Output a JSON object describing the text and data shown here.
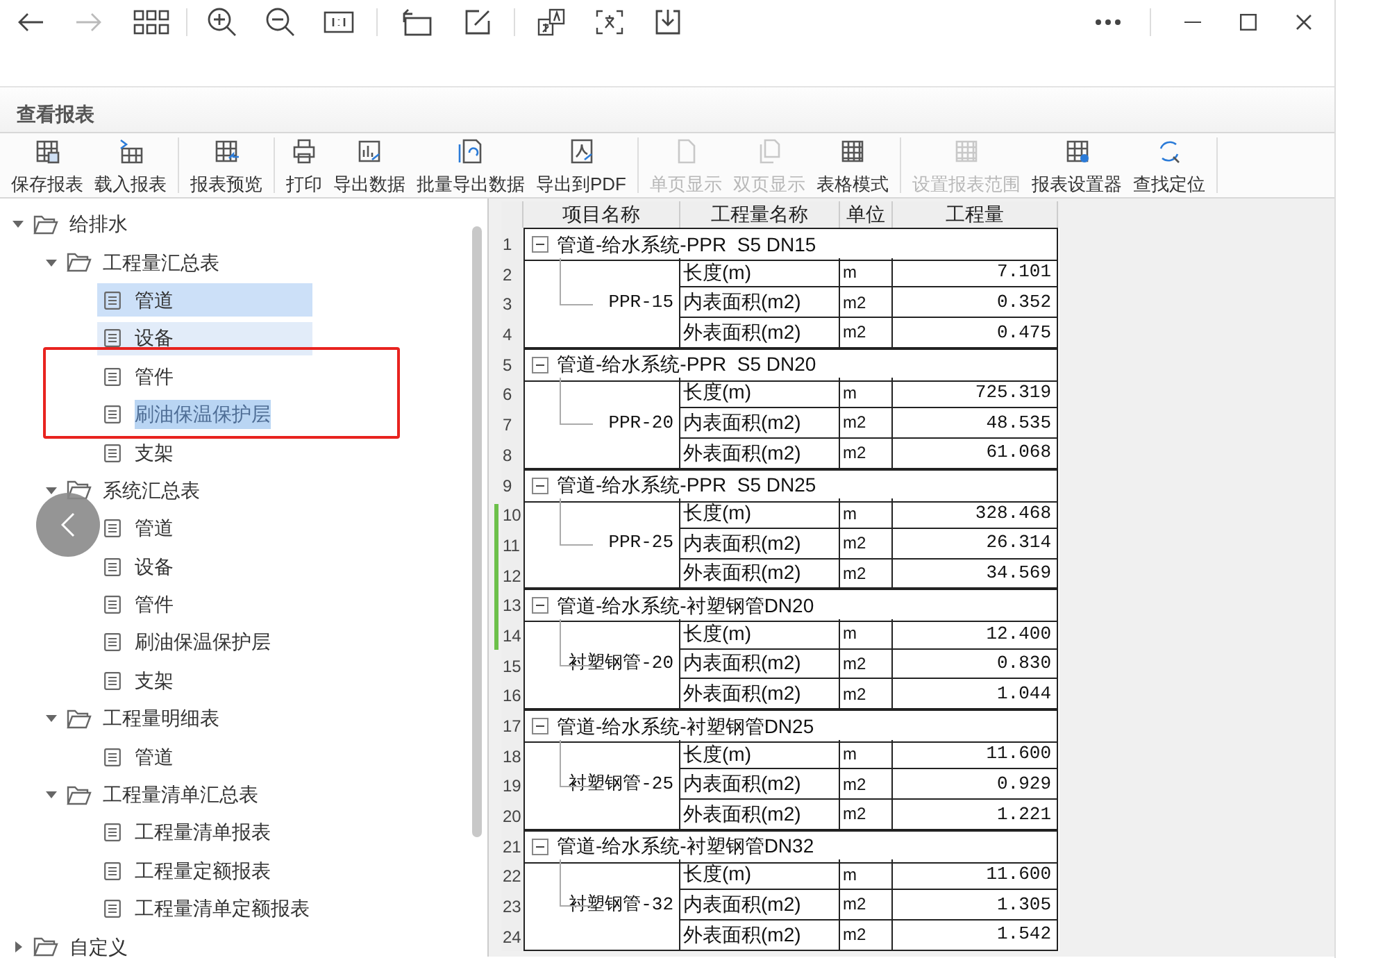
{
  "panel": {
    "title": "查看报表"
  },
  "toolbar": [
    {
      "label": "保存报表",
      "enabled": true,
      "separator_after": false
    },
    {
      "label": "载入报表",
      "enabled": true,
      "separator_after": true
    },
    {
      "label": "报表预览",
      "enabled": true,
      "separator_after": true
    },
    {
      "label": "打印",
      "enabled": true,
      "separator_after": false
    },
    {
      "label": "导出数据",
      "enabled": true,
      "separator_after": false
    },
    {
      "label": "批量导出数据",
      "enabled": true,
      "separator_after": false
    },
    {
      "label": "导出到PDF",
      "enabled": true,
      "separator_after": true
    },
    {
      "label": "单页显示",
      "enabled": false,
      "separator_after": false
    },
    {
      "label": "双页显示",
      "enabled": false,
      "separator_after": false
    },
    {
      "label": "表格模式",
      "enabled": true,
      "separator_after": true
    },
    {
      "label": "设置报表范围",
      "enabled": false,
      "separator_after": false
    },
    {
      "label": "报表设置器",
      "enabled": true,
      "separator_after": false
    },
    {
      "label": "查找定位",
      "enabled": true,
      "separator_after": true
    }
  ],
  "tree": [
    {
      "label": "给排水",
      "expanded": true,
      "children": [
        {
          "label": "工程量汇总表",
          "expanded": true,
          "children": [
            {
              "label": "管道",
              "selected": true,
              "hovered": false,
              "text_highlighted": false
            },
            {
              "label": "设备",
              "selected": false,
              "hovered": true,
              "text_highlighted": false
            },
            {
              "label": "管件",
              "selected": false,
              "hovered": false,
              "text_highlighted": false
            },
            {
              "label": "刷油保温保护层",
              "selected": false,
              "hovered": false,
              "text_highlighted": true
            },
            {
              "label": "支架",
              "selected": false,
              "hovered": false,
              "text_highlighted": false
            }
          ]
        },
        {
          "label": "系统汇总表",
          "expanded": true,
          "children": [
            {
              "label": "管道",
              "selected": false,
              "hovered": false,
              "text_highlighted": false
            },
            {
              "label": "设备",
              "selected": false,
              "hovered": false,
              "text_highlighted": false
            },
            {
              "label": "管件",
              "selected": false,
              "hovered": false,
              "text_highlighted": false
            },
            {
              "label": "刷油保温保护层",
              "selected": false,
              "hovered": false,
              "text_highlighted": false
            },
            {
              "label": "支架",
              "selected": false,
              "hovered": false,
              "text_highlighted": false
            }
          ]
        },
        {
          "label": "工程量明细表",
          "expanded": true,
          "children": [
            {
              "label": "管道",
              "selected": false,
              "hovered": false,
              "text_highlighted": false
            }
          ]
        },
        {
          "label": "工程量清单汇总表",
          "expanded": true,
          "children": [
            {
              "label": "工程量清单报表",
              "selected": false,
              "hovered": false,
              "text_highlighted": false
            },
            {
              "label": "工程量定额报表",
              "selected": false,
              "hovered": false,
              "text_highlighted": false
            },
            {
              "label": "工程量清单定额报表",
              "selected": false,
              "hovered": false,
              "text_highlighted": false
            }
          ]
        }
      ]
    },
    {
      "label": "自定义",
      "expanded": false
    }
  ],
  "table": {
    "columns": [
      "项目名称",
      "工程量名称",
      "单位",
      "工程量"
    ],
    "groups": [
      {
        "number": "1",
        "title": "管道-给水系统-PPR  S5 DN15",
        "item": "PPR-15",
        "rows": [
          {
            "number": "2",
            "name": "长度(m)",
            "unit": "m",
            "value": "7.101"
          },
          {
            "number": "3",
            "name": "内表面积(m2)",
            "unit": "m2",
            "value": "0.352"
          },
          {
            "number": "4",
            "name": "外表面积(m2)",
            "unit": "m2",
            "value": "0.475"
          }
        ]
      },
      {
        "number": "5",
        "title": "管道-给水系统-PPR  S5 DN20",
        "item": "PPR-20",
        "rows": [
          {
            "number": "6",
            "name": "长度(m)",
            "unit": "m",
            "value": "725.319"
          },
          {
            "number": "7",
            "name": "内表面积(m2)",
            "unit": "m2",
            "value": "48.535"
          },
          {
            "number": "8",
            "name": "外表面积(m2)",
            "unit": "m2",
            "value": "61.068"
          }
        ]
      },
      {
        "number": "9",
        "title": "管道-给水系统-PPR  S5 DN25",
        "item": "PPR-25",
        "rows": [
          {
            "number": "10",
            "name": "长度(m)",
            "unit": "m",
            "value": "328.468"
          },
          {
            "number": "11",
            "name": "内表面积(m2)",
            "unit": "m2",
            "value": "26.314"
          },
          {
            "number": "12",
            "name": "外表面积(m2)",
            "unit": "m2",
            "value": "34.569"
          }
        ]
      },
      {
        "number": "13",
        "title": "管道-给水系统-衬塑钢管DN20",
        "item": "衬塑钢管-20",
        "rows": [
          {
            "number": "14",
            "name": "长度(m)",
            "unit": "m",
            "value": "12.400"
          },
          {
            "number": "15",
            "name": "内表面积(m2)",
            "unit": "m2",
            "value": "0.830"
          },
          {
            "number": "16",
            "name": "外表面积(m2)",
            "unit": "m2",
            "value": "1.044"
          }
        ]
      },
      {
        "number": "17",
        "title": "管道-给水系统-衬塑钢管DN25",
        "item": "衬塑钢管-25",
        "rows": [
          {
            "number": "18",
            "name": "长度(m)",
            "unit": "m",
            "value": "11.600"
          },
          {
            "number": "19",
            "name": "内表面积(m2)",
            "unit": "m2",
            "value": "0.929"
          },
          {
            "number": "20",
            "name": "外表面积(m2)",
            "unit": "m2",
            "value": "1.221"
          }
        ]
      },
      {
        "number": "21",
        "title": "管道-给水系统-衬塑钢管DN32",
        "item": "衬塑钢管-32",
        "rows": [
          {
            "number": "22",
            "name": "长度(m)",
            "unit": "m",
            "value": "11.600"
          },
          {
            "number": "23",
            "name": "内表面积(m2)",
            "unit": "m2",
            "value": "1.305"
          },
          {
            "number": "24",
            "name": "外表面积(m2)",
            "unit": "m2",
            "value": "1.542"
          }
        ]
      }
    ]
  }
}
